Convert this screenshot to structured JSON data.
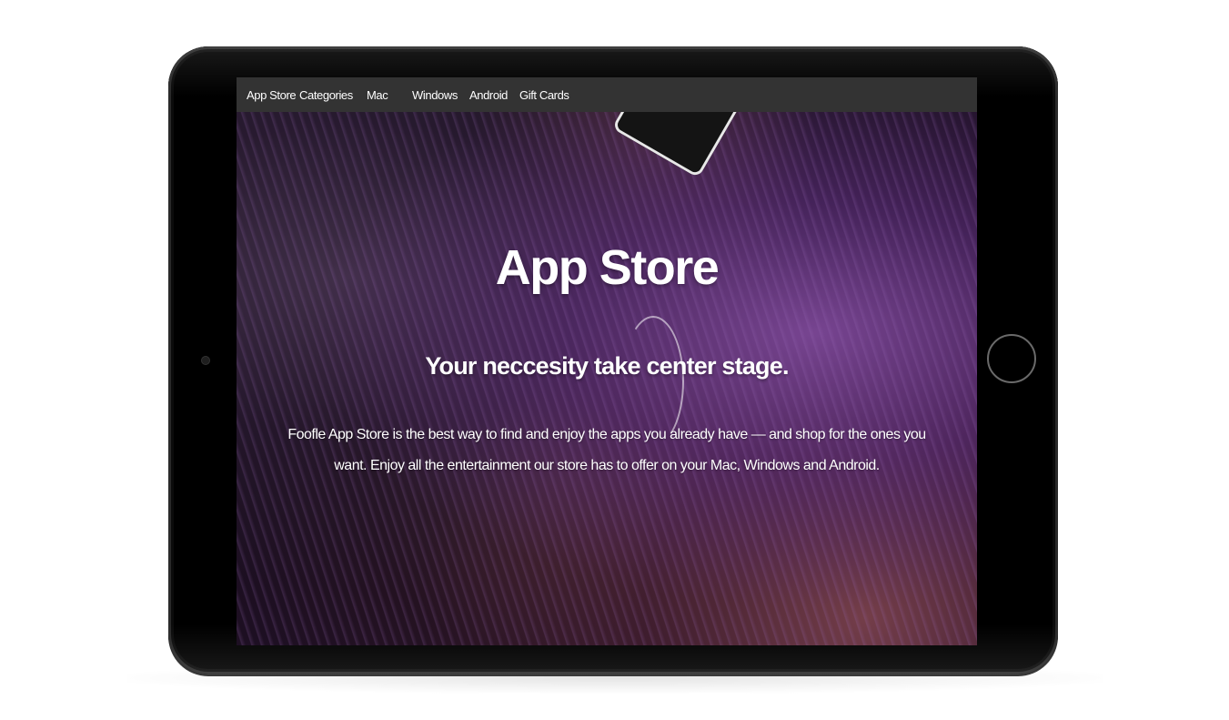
{
  "navbar": {
    "items": [
      {
        "label": "App Store"
      },
      {
        "label": "Categories"
      },
      {
        "label": "Mac"
      },
      {
        "label": "Windows"
      },
      {
        "label": "Android"
      },
      {
        "label": "Gift Cards"
      }
    ]
  },
  "hero": {
    "title": "App Store",
    "subtitle": "Your neccesity take center stage.",
    "body": "Foofle App Store is the best way to find and enjoy the apps you already have — and shop for the ones you want. Enjoy all the entertainment our store has to offer on your Mac, Windows and Android."
  },
  "colors": {
    "navbar_bg": "#333333",
    "text": "#ffffff",
    "device": "#000000"
  }
}
